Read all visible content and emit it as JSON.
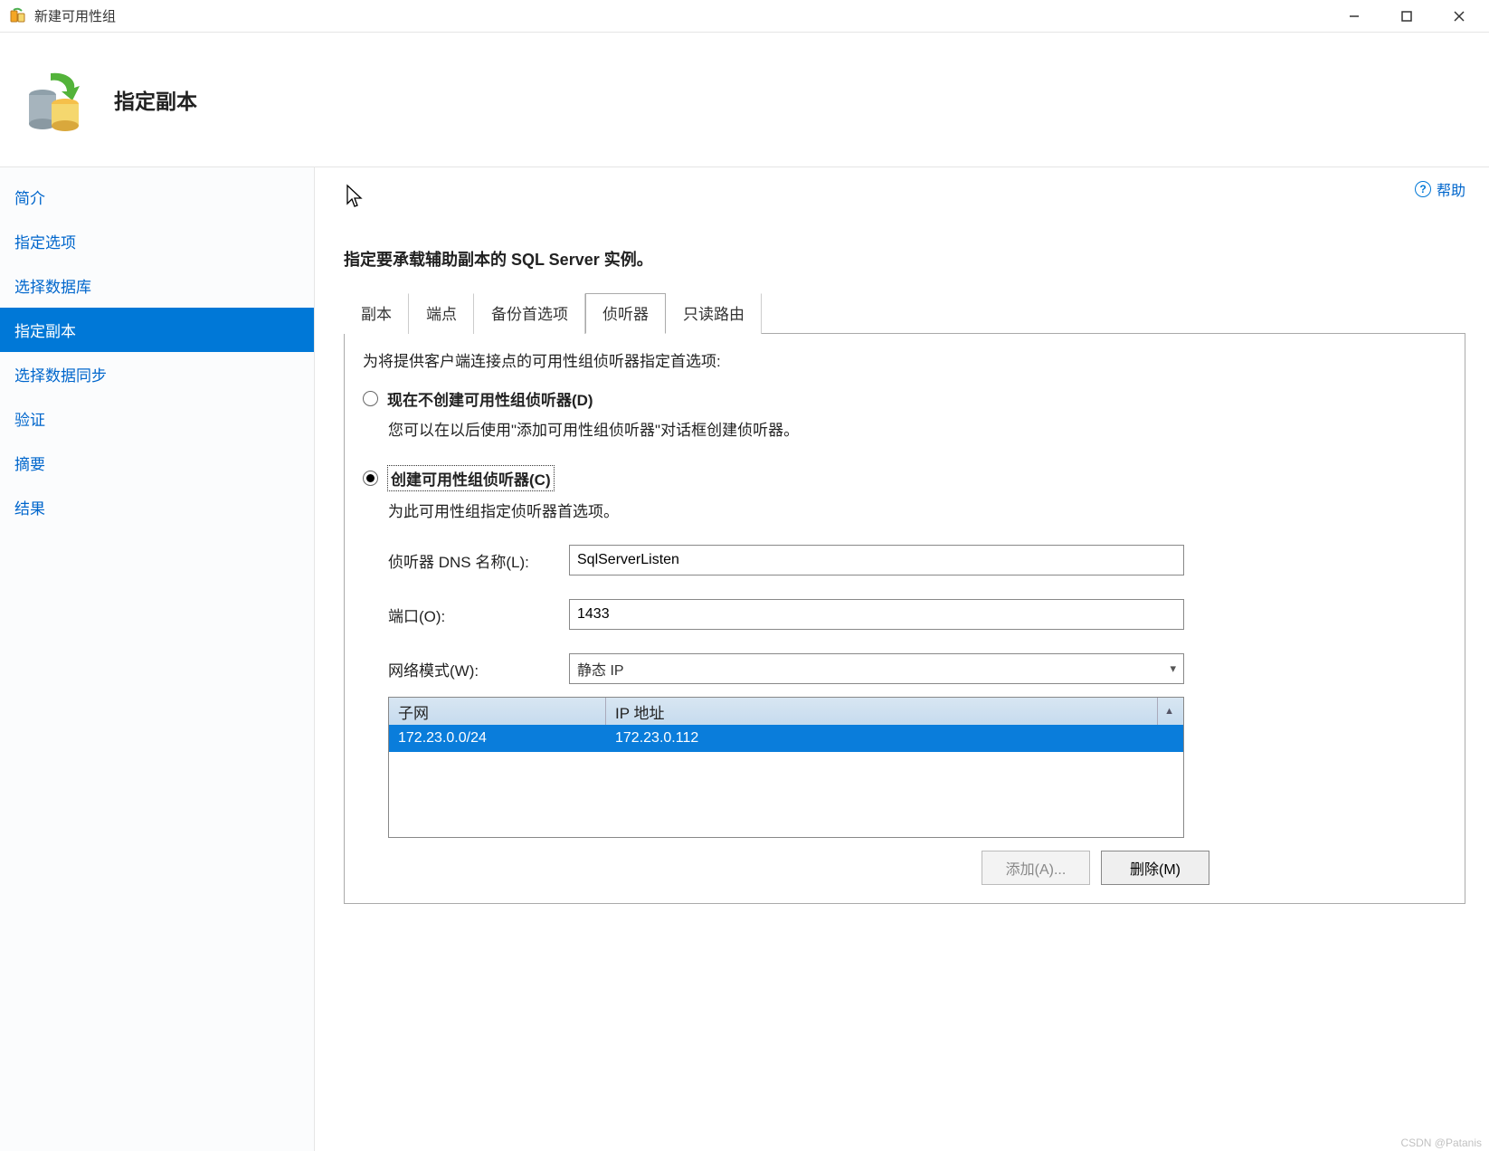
{
  "window": {
    "title": "新建可用性组",
    "minimize": "–",
    "maximize": "☐",
    "close": "✕"
  },
  "header": {
    "title": "指定副本"
  },
  "nav": {
    "items": [
      {
        "label": "简介"
      },
      {
        "label": "指定选项"
      },
      {
        "label": "选择数据库"
      },
      {
        "label": "指定副本"
      },
      {
        "label": "选择数据同步"
      },
      {
        "label": "验证"
      },
      {
        "label": "摘要"
      },
      {
        "label": "结果"
      }
    ],
    "selected_index": 3
  },
  "help": {
    "label": "帮助"
  },
  "instruction": "指定要承载辅助副本的 SQL Server 实例。",
  "tabs": {
    "items": [
      {
        "label": "副本"
      },
      {
        "label": "端点"
      },
      {
        "label": "备份首选项"
      },
      {
        "label": "侦听器"
      },
      {
        "label": "只读路由"
      }
    ],
    "active_index": 3
  },
  "listener_panel": {
    "intro": "为将提供客户端连接点的可用性组侦听器指定首选项:",
    "option_no_create": {
      "label": "现在不创建可用性组侦听器(D)",
      "desc": "您可以在以后使用\"添加可用性组侦听器\"对话框创建侦听器。"
    },
    "option_create": {
      "label": "创建可用性组侦听器(C)",
      "desc": "为此可用性组指定侦听器首选项。"
    },
    "form": {
      "dns_label": "侦听器 DNS 名称(L):",
      "dns_value": "SqlServerListen",
      "port_label": "端口(O):",
      "port_value": "1433",
      "netmode_label": "网络模式(W):",
      "netmode_value": "静态 IP"
    },
    "grid": {
      "headers": {
        "subnet": "子网",
        "ip": "IP 地址"
      },
      "rows": [
        {
          "subnet": "172.23.0.0/24",
          "ip": "172.23.0.112"
        }
      ]
    },
    "buttons": {
      "add": "添加(A)...",
      "delete": "删除(M)"
    }
  },
  "watermark": "CSDN @Patanis"
}
